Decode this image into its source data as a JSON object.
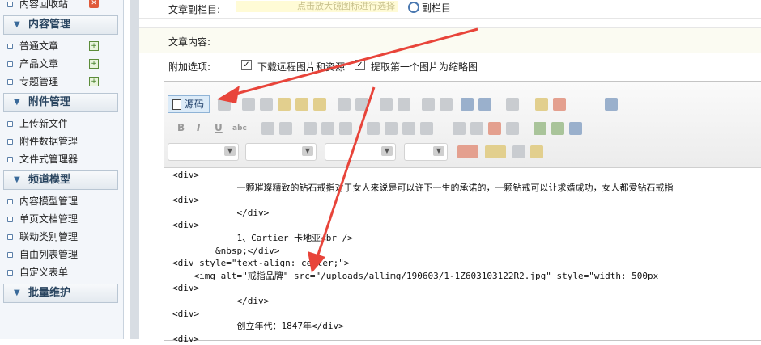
{
  "sidebar": {
    "top_item": "内容回收站",
    "sections": [
      {
        "title": "内容管理",
        "items": [
          {
            "label": "普通文章",
            "action": "add"
          },
          {
            "label": "产品文章",
            "action": "add"
          },
          {
            "label": "专题管理",
            "action": "add"
          }
        ]
      },
      {
        "title": "附件管理",
        "items": [
          {
            "label": "上传新文件"
          },
          {
            "label": "附件数据管理"
          },
          {
            "label": "文件式管理器"
          }
        ]
      },
      {
        "title": "频道模型",
        "items": [
          {
            "label": "内容模型管理"
          },
          {
            "label": "单页文档管理"
          },
          {
            "label": "联动类别管理"
          },
          {
            "label": "自由列表管理"
          },
          {
            "label": "自定义表单"
          }
        ]
      },
      {
        "title": "批量维护",
        "items": []
      }
    ]
  },
  "form": {
    "subcolumn_label": "文章副栏目:",
    "subcolumn_hint": "点击放大镜图标进行选择",
    "subcolumn_link": "副栏目",
    "content_label": "文章内容:",
    "options_label": "附加选项:",
    "option1": "下载远程图片和资源",
    "option2": "提取第一个图片为缩略图"
  },
  "editor": {
    "source_button": "源码",
    "code_lines": [
      "<div>",
      "            一颗璀璨精致的钻石戒指对于女人来说是可以许下一生的承诺的，一颗钻戒可以让求婚成功，女人都爱钻石戒指",
      "<div>",
      "            </div>",
      "<div>",
      "            1、Cartier 卡地亚<br />",
      "        &nbsp;</div>",
      "<div style=\"text-align: center;\">",
      "    <img alt=\"戒指品牌\" src=\"/uploads/allimg/190603/1-1Z603103122R2.jpg\" style=\"width: 500px",
      "<div>",
      "            </div>",
      "<div>",
      "            创立年代：1847年</div>",
      "<div>"
    ]
  },
  "colors": {
    "arrow": "#e8443a",
    "accent": "#2a4560"
  }
}
